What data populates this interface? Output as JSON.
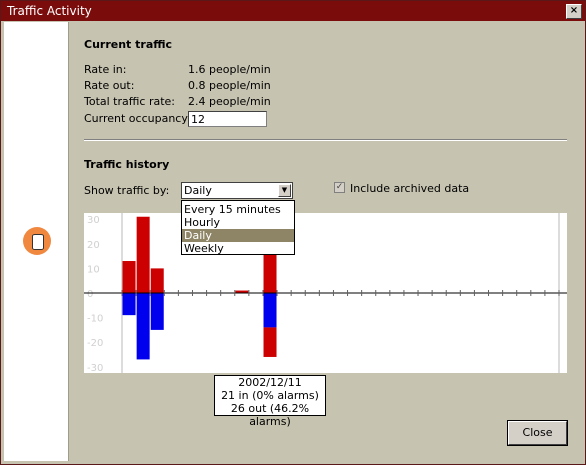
{
  "window": {
    "title": "Traffic Activity",
    "close_glyph": "×"
  },
  "current": {
    "heading": "Current traffic",
    "rows": [
      {
        "label": "Rate in:",
        "value": "1.6 people/min"
      },
      {
        "label": "Rate out:",
        "value": "0.8 people/min"
      },
      {
        "label": "Total traffic rate:",
        "value": "2.4 people/min"
      }
    ],
    "occupancy_label": "Current occupancy:",
    "occupancy_value": "12"
  },
  "history": {
    "heading": "Traffic history",
    "show_by_label": "Show traffic by:",
    "selected": "Daily",
    "options": [
      "Every 15 minutes",
      "Hourly",
      "Daily",
      "Weekly"
    ],
    "archived_label": "Include archived data",
    "archived_checked": true
  },
  "tooltip": {
    "line1": "2002/12/11",
    "line2": "21 in (0% alarms)",
    "line3": "26 out (46.2% alarms)"
  },
  "close_label": "Close",
  "icons": {
    "left": "database-icon",
    "dropdown": "chevron-down-icon",
    "check": "check-icon"
  },
  "colors": {
    "titlebar": "#7a0c0c",
    "in": "#cc0000",
    "out": "#0000ee",
    "alarm": "#cc0000",
    "dialog": "#c6c3b0"
  },
  "chart_data": {
    "type": "bar",
    "yticks": [
      30,
      20,
      10,
      0,
      -10,
      -20,
      -30
    ],
    "ylim": [
      -32,
      32
    ],
    "n_days": 31,
    "series": [
      {
        "values_in": [
          13,
          31,
          10,
          0,
          0,
          0,
          0,
          0,
          1,
          0,
          21,
          0,
          0,
          0,
          0,
          0,
          0,
          0,
          0,
          0,
          0,
          0,
          0,
          0,
          0,
          0,
          0,
          0,
          0,
          0,
          0
        ],
        "values_out": [
          -9,
          -27,
          -15,
          0,
          0,
          0,
          0,
          0,
          0,
          0,
          -26,
          0,
          0,
          0,
          0,
          0,
          0,
          0,
          0,
          0,
          0,
          0,
          0,
          0,
          0,
          0,
          0,
          0,
          0,
          0,
          0
        ],
        "alarm_fraction_out": [
          0,
          0,
          0,
          0,
          0,
          0,
          0,
          0,
          0,
          0,
          0.462,
          0,
          0,
          0,
          0,
          0,
          0,
          0,
          0,
          0,
          0,
          0,
          0,
          0,
          0,
          0,
          0,
          0,
          0,
          0,
          0
        ]
      }
    ]
  }
}
